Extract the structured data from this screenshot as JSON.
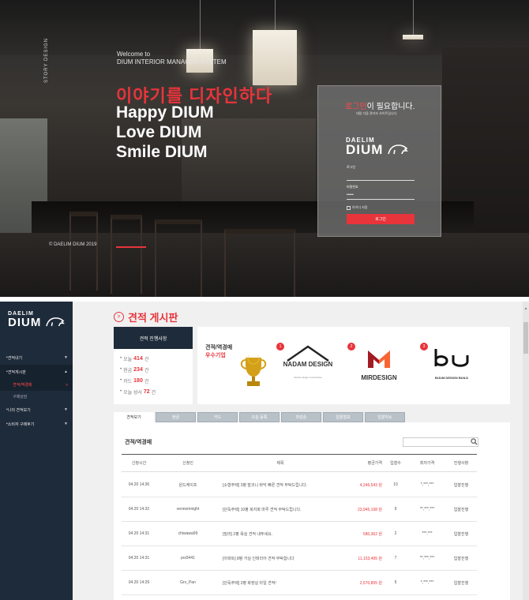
{
  "hero": {
    "story_label": "STORY DESIGN",
    "welcome_line1": "Welcome to",
    "welcome_line2": "DIUM INTERIOR MANAGER SYSTEM",
    "slogan_red": "이야기를 디자인하다",
    "slogan_lines": [
      "Happy DIUM",
      "Love DIUM",
      "Smile DIUM"
    ],
    "copyright": "© DAELIM DIUM 2019",
    "accent": "#e8343b"
  },
  "login": {
    "title_red": "로그인",
    "title_rest": "이 필요합니다.",
    "subtitle": "대림 디움 관리자 사이트입니다.",
    "logo_top": "DAELIM",
    "logo_main": "DIUM",
    "id_label": "로그인",
    "id_value": "",
    "pw_label": "비밀번호",
    "pw_value": "•••••",
    "remember_label": "아이디 저장",
    "submit_label": "로그인"
  },
  "sidebar": {
    "logo_top": "DAELIM",
    "logo_main": "DIUM",
    "items": [
      {
        "label": "견적내기"
      },
      {
        "label": "견적게시판"
      },
      {
        "label": "견적/역경매"
      },
      {
        "label": "구매상담"
      },
      {
        "label": "나의 견적보기"
      },
      {
        "label": "소비자 구매후기"
      }
    ]
  },
  "page": {
    "title": "견적 게시판"
  },
  "status": {
    "header": "견적 진행사항",
    "items": [
      {
        "label": "오늘",
        "value": "414",
        "unit": "건"
      },
      {
        "label": "현금",
        "value": "234",
        "unit": "건"
      },
      {
        "label": "카드",
        "value": "180",
        "unit": "건"
      },
      {
        "label": "오늘 성사",
        "value": "72",
        "unit": "건"
      }
    ]
  },
  "partners": {
    "title_line1": "견적/역경매",
    "title_line2": "우수기업",
    "items": [
      {
        "rank": "1",
        "name": "NADAM DESIGN",
        "tagline": "interior design construction"
      },
      {
        "rank": "2",
        "name": "MIRDESIGN",
        "tagline": ""
      },
      {
        "rank": "3",
        "name": "BIJUM DESIGN BUILD",
        "tagline": ""
      }
    ]
  },
  "tabs": [
    "견적보기",
    "현금",
    "카드",
    "오늘 등록",
    "마감순",
    "입찰형보",
    "입찰취소"
  ],
  "board": {
    "title": "견적/역경매",
    "search_placeholder": "",
    "columns": [
      "신청시간",
      "신청인",
      "제목",
      "평균가격",
      "입찰수",
      "최저가격",
      "진행사항"
    ],
    "rows": [
      [
        "04.20 14:36",
        "윈드케이프",
        "[소형주택] 3평 발코니 바닥 빠른 견적 부탁드립니다.",
        "4,246,543 원",
        "10",
        "*,***,***",
        "입찰진행"
      ],
      [
        "04.20 14:32",
        "vennomnight",
        "[단독주택] 10평 복지화 마루 견적 부탁드립니다.",
        "23,945,108 원",
        "9",
        "**,***,***",
        "입찰진행"
      ],
      [
        "04.20 14:31",
        "chiwawa99",
        "[빌라] 2평 욕실 견적 내주세요.",
        "580,362 원",
        "2",
        "***,***",
        "입찰진행"
      ],
      [
        "04.20 14:31",
        "poi3441",
        "[아파트] 8평 거실 인테리어 견적 부탁합니다",
        "11,153,495 원",
        "7",
        "**,***,***",
        "입찰진행"
      ],
      [
        "04.20 14:29",
        "Grv_Pan",
        "[단독주택] 2평 화장실 타일 견적!",
        "2,570,855 원",
        "5",
        "*,***,***",
        "입찰진행"
      ]
    ]
  }
}
